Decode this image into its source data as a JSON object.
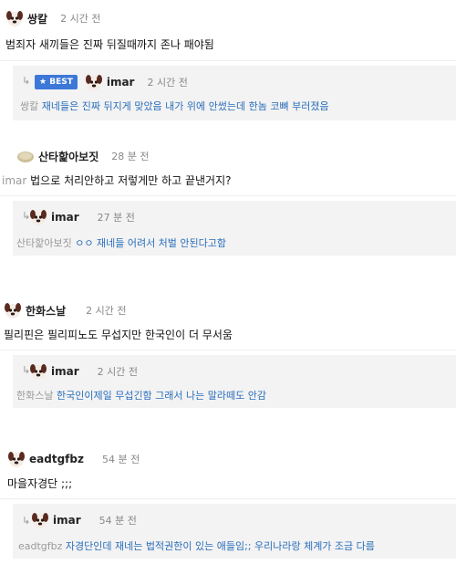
{
  "threads": [
    {
      "comment": {
        "author": "쌍칼",
        "time": "2 시간 전",
        "text": "범죄자 새끼들은 진짜 뒤질때까지 존나 패야됨",
        "avatar": "dog-avatar"
      },
      "reply": {
        "badge": "BEST",
        "author": "imar",
        "time": "2 시간 전",
        "mention": "쌍칼",
        "text": "재네들은 진짜 뒤지게 맞았음 내가 위에 안썼는데 한놈 코뼈 부러졌음",
        "avatar": "dog-avatar"
      }
    },
    {
      "comment": {
        "author": "산타핥아보짓",
        "time": "28 분 전",
        "text": "법으로 처리안하고 저렇게만 하고 끝낸거지?",
        "mention": "imar",
        "avatar": "bread-avatar"
      },
      "reply": {
        "author": "imar",
        "time": "27 분 전",
        "mention": "산타핥아보짓",
        "text": "ㅇㅇ 재네들 어려서 처벌 안된다고함",
        "avatar": "dog-avatar"
      }
    },
    {
      "comment": {
        "author": "한화스날",
        "time": "2 시간 전",
        "text": "필리핀은 필리피노도 무섭지만 한국인이 더 무서움",
        "avatar": "dog-avatar"
      },
      "reply": {
        "author": "imar",
        "time": "2 시간 전",
        "mention": "한화스날",
        "text": "한국인이제일 무섭긴함 그래서 나는 말라떼도 안감",
        "avatar": "dog-avatar"
      }
    },
    {
      "comment": {
        "author": "eadtgfbz",
        "time": "54 분 전",
        "text": "마을자경단 ;;;",
        "avatar": "dog-avatar"
      },
      "reply": {
        "author": "imar",
        "time": "54 분 전",
        "mention": "eadtgfbz",
        "text": "자경단인데 재네는 법적권한이 있는 애들임;; 우리나라랑 체계가 조금 다름",
        "avatar": "dog-avatar"
      }
    }
  ],
  "icons": {
    "reply_arrow": "reply-arrow-icon",
    "star": "star-icon"
  },
  "colors": {
    "link_blue": "#2a6ebb",
    "best_badge": "#3d78d8",
    "reply_bg": "#f3f3f3",
    "meta_gray": "#888888"
  }
}
